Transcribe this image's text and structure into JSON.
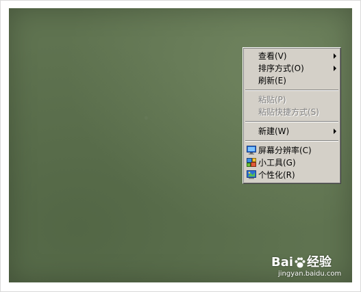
{
  "menu": {
    "items": [
      {
        "label": "查看(V)",
        "submenu": true,
        "disabled": false
      },
      {
        "label": "排序方式(O)",
        "submenu": true,
        "disabled": false
      },
      {
        "label": "刷新(E)",
        "submenu": false,
        "disabled": false
      },
      {
        "label": "粘贴(P)",
        "submenu": false,
        "disabled": true
      },
      {
        "label": "粘贴快捷方式(S)",
        "submenu": false,
        "disabled": true
      },
      {
        "label": "新建(W)",
        "submenu": true,
        "disabled": false
      },
      {
        "label": "屏幕分辨率(C)",
        "icon": "screen-resolution-icon",
        "disabled": false
      },
      {
        "label": "小工具(G)",
        "icon": "gadgets-icon",
        "disabled": false
      },
      {
        "label": "个性化(R)",
        "icon": "personalize-icon",
        "disabled": false
      }
    ]
  },
  "watermark": {
    "brand_left": "Bai",
    "brand_right": "经验",
    "url": "jingyan.baidu.com"
  },
  "colors": {
    "desktop": "#5f7350",
    "menu_bg": "#d4d0c8",
    "disabled_text": "#808080"
  }
}
